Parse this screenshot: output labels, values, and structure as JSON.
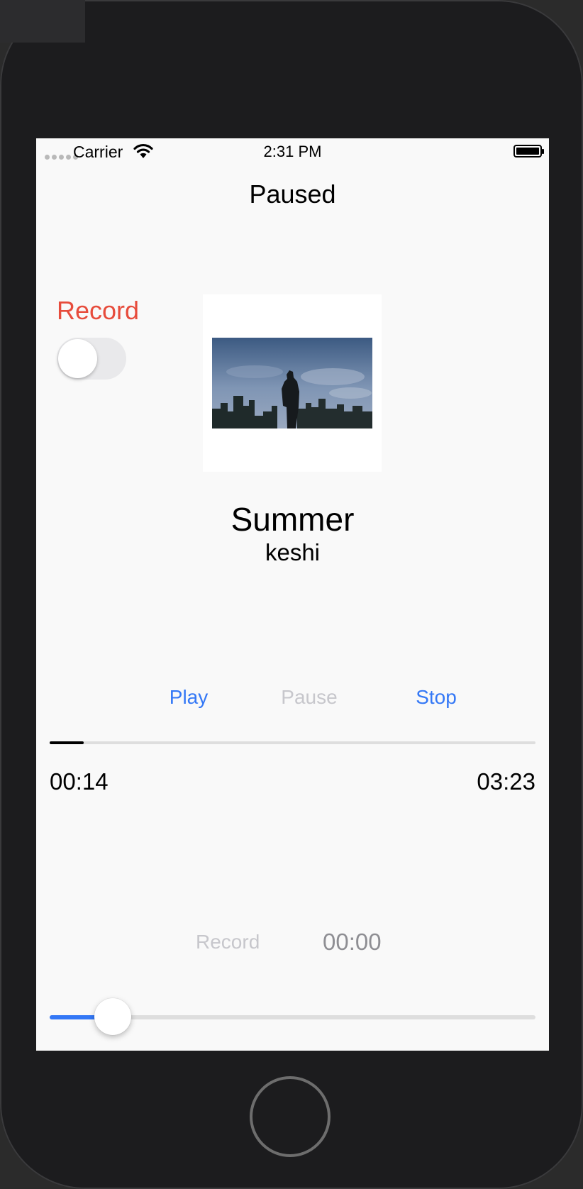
{
  "status_bar": {
    "carrier": "Carrier",
    "time": "2:31 PM"
  },
  "player": {
    "state": "Paused",
    "song_title": "Summer",
    "artist": "keshi",
    "controls": {
      "play": "Play",
      "pause": "Pause",
      "stop": "Stop"
    },
    "elapsed": "00:14",
    "duration": "03:23",
    "progress_fraction": 0.07
  },
  "record": {
    "label": "Record",
    "toggle_on": false,
    "button_label": "Record",
    "time": "00:00"
  },
  "volume": {
    "level_fraction": 0.13
  },
  "colors": {
    "accent": "#3478f6",
    "record_red": "#e74c3c",
    "disabled": "#c7c7cc",
    "screen_bg": "#f9f9f9"
  },
  "icons": [
    "signal-dots-icon",
    "wifi-icon",
    "battery-icon",
    "home-button"
  ]
}
